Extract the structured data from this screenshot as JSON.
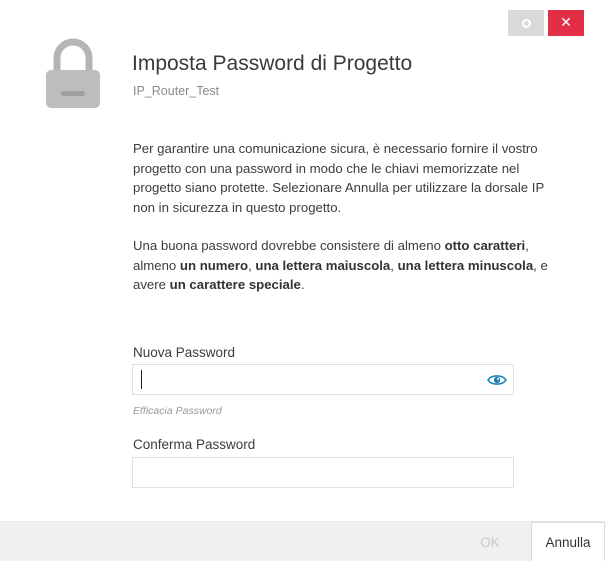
{
  "window": {
    "restore_icon": "restore-icon",
    "close_icon": "close-icon",
    "close_color": "#e32f45"
  },
  "header": {
    "icon": "padlock-icon",
    "title": "Imposta Password di Progetto",
    "subtitle": "IP_Router_Test"
  },
  "body": {
    "paragraph1": "Per garantire una comunicazione sicura, è necessario fornire il vostro progetto con una password in modo che le chiavi memorizzate nel progetto siano protette. Selezionare Annulla per utilizzare la dorsale IP non in sicurezza in questo progetto.",
    "paragraph2": {
      "t1": "Una buona password dovrebbe consistere di almeno ",
      "b1": "otto caratteri",
      "t2": ", almeno ",
      "b2": "un numero",
      "t3": ", ",
      "b3": "una lettera maiuscola",
      "t4": ", ",
      "b4": "una lettera minuscola",
      "t5": ", e avere ",
      "b5": "un carattere speciale",
      "t6": "."
    }
  },
  "form": {
    "new_password": {
      "label": "Nuova Password",
      "value": "",
      "toggle_icon": "eye-icon",
      "strength_label": "Efficacia Password"
    },
    "confirm_password": {
      "label": "Conferma Password",
      "value": ""
    }
  },
  "footer": {
    "ok_label": "OK",
    "ok_enabled": false,
    "cancel_label": "Annulla"
  }
}
